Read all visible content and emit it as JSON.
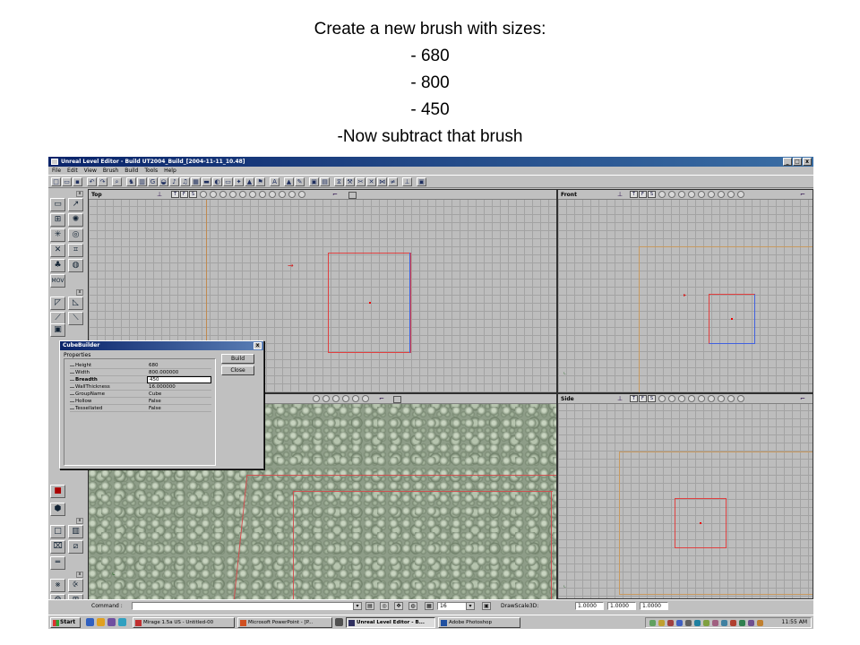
{
  "caption": {
    "line1": "Create a new brush with sizes:",
    "line2": "- 680",
    "line3": "- 800",
    "line4": "- 450",
    "line5": "-Now subtract that brush"
  },
  "window": {
    "title": "Unreal Level Editor - Build UT2004_Build_[2004-11-11_10.48]",
    "min": "_",
    "max": "□",
    "close": "x"
  },
  "menu": [
    "File",
    "Edit",
    "View",
    "Brush",
    "Build",
    "Tools",
    "Help"
  ],
  "viewports": {
    "top": "Top",
    "front": "Front",
    "side": "Side",
    "mode_btns": [
      "T",
      "F",
      "S"
    ]
  },
  "cube_builder": {
    "title": "CubeBuilder",
    "properties_label": "Properties",
    "rows": [
      {
        "name": "Height",
        "value": "680"
      },
      {
        "name": "Width",
        "value": "800.000000"
      },
      {
        "name": "Breadth",
        "value": "450"
      },
      {
        "name": "WallThickness",
        "value": "16.000000"
      },
      {
        "name": "GroupName",
        "value": "Cube"
      },
      {
        "name": "Hollow",
        "value": "False"
      },
      {
        "name": "Tessellated",
        "value": "False"
      }
    ],
    "build": "Build",
    "close": "Close",
    "close_x": "x"
  },
  "command_bar": {
    "command_label": "Command :",
    "grid_size": "16",
    "drawscale_label": "DrawScale3D:",
    "scale_x": "1.0000",
    "scale_y": "1.0000",
    "scale_z": "1.0000"
  },
  "taskbar": {
    "start": "Start",
    "tasks": [
      "Mirage 1.5a US - Untitled-00",
      "Microsoft PowerPoint - [P...",
      "Unreal Level Editor - B...",
      "Adobe Photoshop"
    ],
    "clock": "11:55 AM"
  },
  "colors": {
    "brush_red": "#e04040",
    "titlebar_blue": "#0a246a",
    "builder_orange": "#c08a50",
    "grid_bg": "#bdbdbd"
  }
}
